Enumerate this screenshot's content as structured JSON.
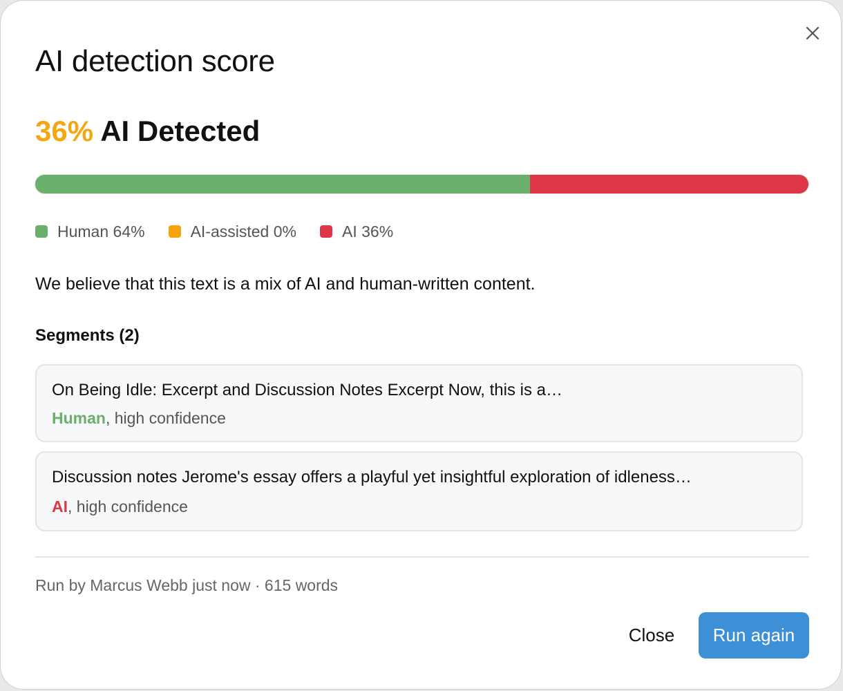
{
  "dialog": {
    "title": "AI detection score",
    "close_icon": "close-icon"
  },
  "score": {
    "percent_label": "36%",
    "label": "AI Detected",
    "accent_color": "#f3a712"
  },
  "breakdown": {
    "segments": [
      {
        "name": "human",
        "label": "Human 64%",
        "percent": 64,
        "color": "#6aaf6b"
      },
      {
        "name": "ai-assisted",
        "label": "AI-assisted 0%",
        "percent": 0,
        "color": "#f5a50b"
      },
      {
        "name": "ai",
        "label": "AI 36%",
        "percent": 36,
        "color": "#dd3646"
      }
    ]
  },
  "summary": "We believe that this text is a mix of AI and human-written content.",
  "segments_heading": "Segments (2)",
  "segments": [
    {
      "text": "On Being Idle: Excerpt and Discussion Notes Excerpt Now, this is a…",
      "tag": "Human",
      "tag_color": "#6aaf6b",
      "confidence": ", high confidence"
    },
    {
      "text": "Discussion notes Jerome's essay offers a playful yet insightful exploration of idleness…",
      "tag": "AI",
      "tag_color": "#dd3646",
      "confidence": ", high confidence"
    }
  ],
  "footer": {
    "meta": "Run by Marcus Webb just now · 615 words",
    "close_label": "Close",
    "run_again_label": "Run again",
    "primary_color": "#3d8fd6"
  }
}
